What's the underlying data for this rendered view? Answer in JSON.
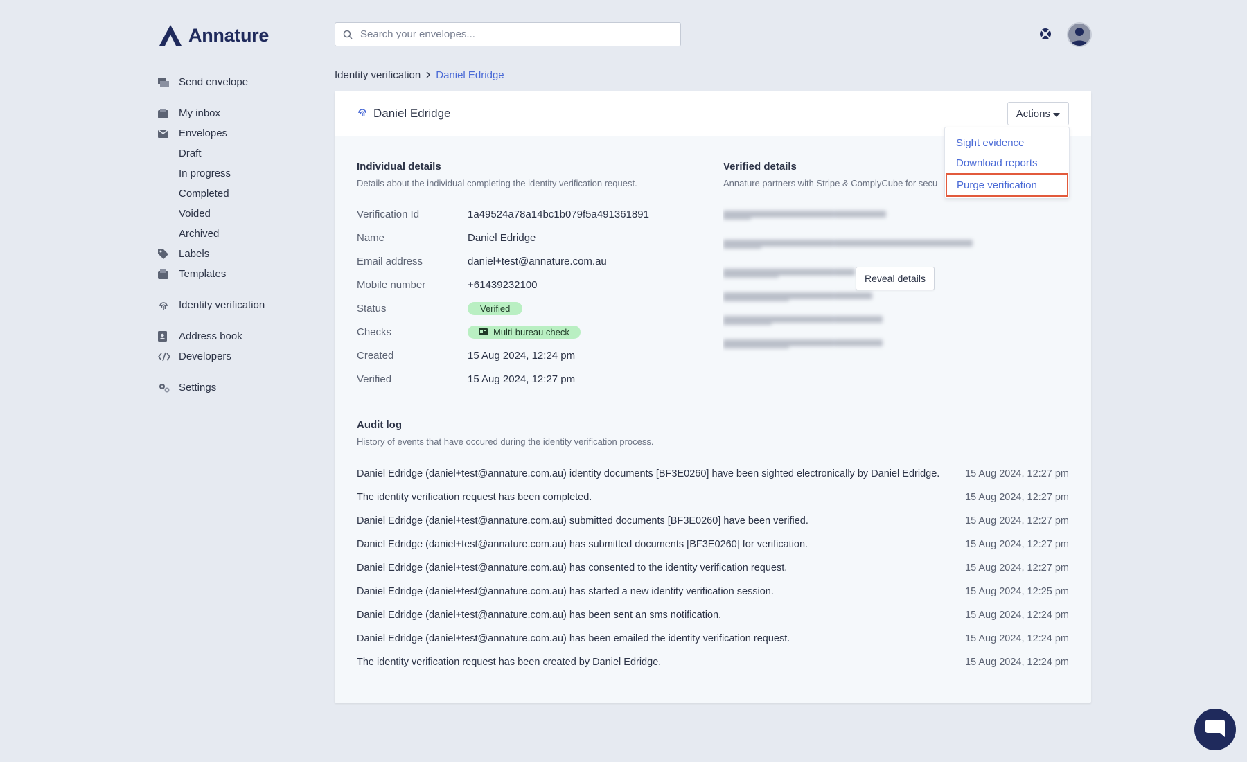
{
  "app": {
    "name": "Annature"
  },
  "search": {
    "placeholder": "Search your envelopes..."
  },
  "sidebar": {
    "items": [
      {
        "label": "Send envelope"
      },
      {
        "label": "My inbox"
      },
      {
        "label": "Envelopes"
      },
      {
        "label": "Draft"
      },
      {
        "label": "In progress"
      },
      {
        "label": "Completed"
      },
      {
        "label": "Voided"
      },
      {
        "label": "Archived"
      },
      {
        "label": "Labels"
      },
      {
        "label": "Templates"
      },
      {
        "label": "Identity verification"
      },
      {
        "label": "Address book"
      },
      {
        "label": "Developers"
      },
      {
        "label": "Settings"
      }
    ]
  },
  "breadcrumb": {
    "root": "Identity verification",
    "current": "Daniel Edridge"
  },
  "card": {
    "title": "Daniel Edridge",
    "actions_label": "Actions"
  },
  "dropdown": {
    "items": [
      {
        "label": "Sight evidence"
      },
      {
        "label": "Download reports"
      },
      {
        "label": "Purge verification"
      }
    ]
  },
  "individual": {
    "title": "Individual details",
    "subtitle": "Details about the individual completing the identity verification request.",
    "rows": [
      {
        "key": "Verification Id",
        "value": "1a49524a78a14bc1b079f5a491361891"
      },
      {
        "key": "Name",
        "value": "Daniel Edridge"
      },
      {
        "key": "Email address",
        "value": "daniel+test@annature.com.au"
      },
      {
        "key": "Mobile number",
        "value": "+61439232100"
      },
      {
        "key": "Status",
        "value": "Verified"
      },
      {
        "key": "Checks",
        "value": "Multi-bureau check"
      },
      {
        "key": "Created",
        "value": "15 Aug 2024, 12:24 pm"
      },
      {
        "key": "Verified",
        "value": "15 Aug 2024, 12:27 pm"
      }
    ]
  },
  "verified": {
    "title": "Verified details",
    "subtitle": "Annature partners with Stripe & ComplyCube for secu",
    "reveal_label": "Reveal details"
  },
  "audit": {
    "title": "Audit log",
    "subtitle": "History of events that have occured during the identity verification process.",
    "rows": [
      {
        "msg": "Daniel Edridge (daniel+test@annature.com.au) identity documents [BF3E0260] have been sighted electronically by Daniel Edridge.",
        "time": "15 Aug 2024, 12:27 pm"
      },
      {
        "msg": "The identity verification request has been completed.",
        "time": "15 Aug 2024, 12:27 pm"
      },
      {
        "msg": "Daniel Edridge (daniel+test@annature.com.au) submitted documents [BF3E0260] have been verified.",
        "time": "15 Aug 2024, 12:27 pm"
      },
      {
        "msg": "Daniel Edridge (daniel+test@annature.com.au) has submitted documents [BF3E0260] for verification.",
        "time": "15 Aug 2024, 12:27 pm"
      },
      {
        "msg": "Daniel Edridge (daniel+test@annature.com.au) has consented to the identity verification request.",
        "time": "15 Aug 2024, 12:27 pm"
      },
      {
        "msg": "Daniel Edridge (daniel+test@annature.com.au) has started a new identity verification session.",
        "time": "15 Aug 2024, 12:25 pm"
      },
      {
        "msg": "Daniel Edridge (daniel+test@annature.com.au) has been sent an sms notification.",
        "time": "15 Aug 2024, 12:24 pm"
      },
      {
        "msg": "Daniel Edridge (daniel+test@annature.com.au) has been emailed the identity verification request.",
        "time": "15 Aug 2024, 12:24 pm"
      },
      {
        "msg": "The identity verification request has been created by Daniel Edridge.",
        "time": "15 Aug 2024, 12:24 pm"
      }
    ]
  },
  "colors": {
    "brand": "#1f2a5c",
    "link": "#4a6ad6",
    "highlight": "#e25a3c",
    "badge": "#b9efc2"
  }
}
